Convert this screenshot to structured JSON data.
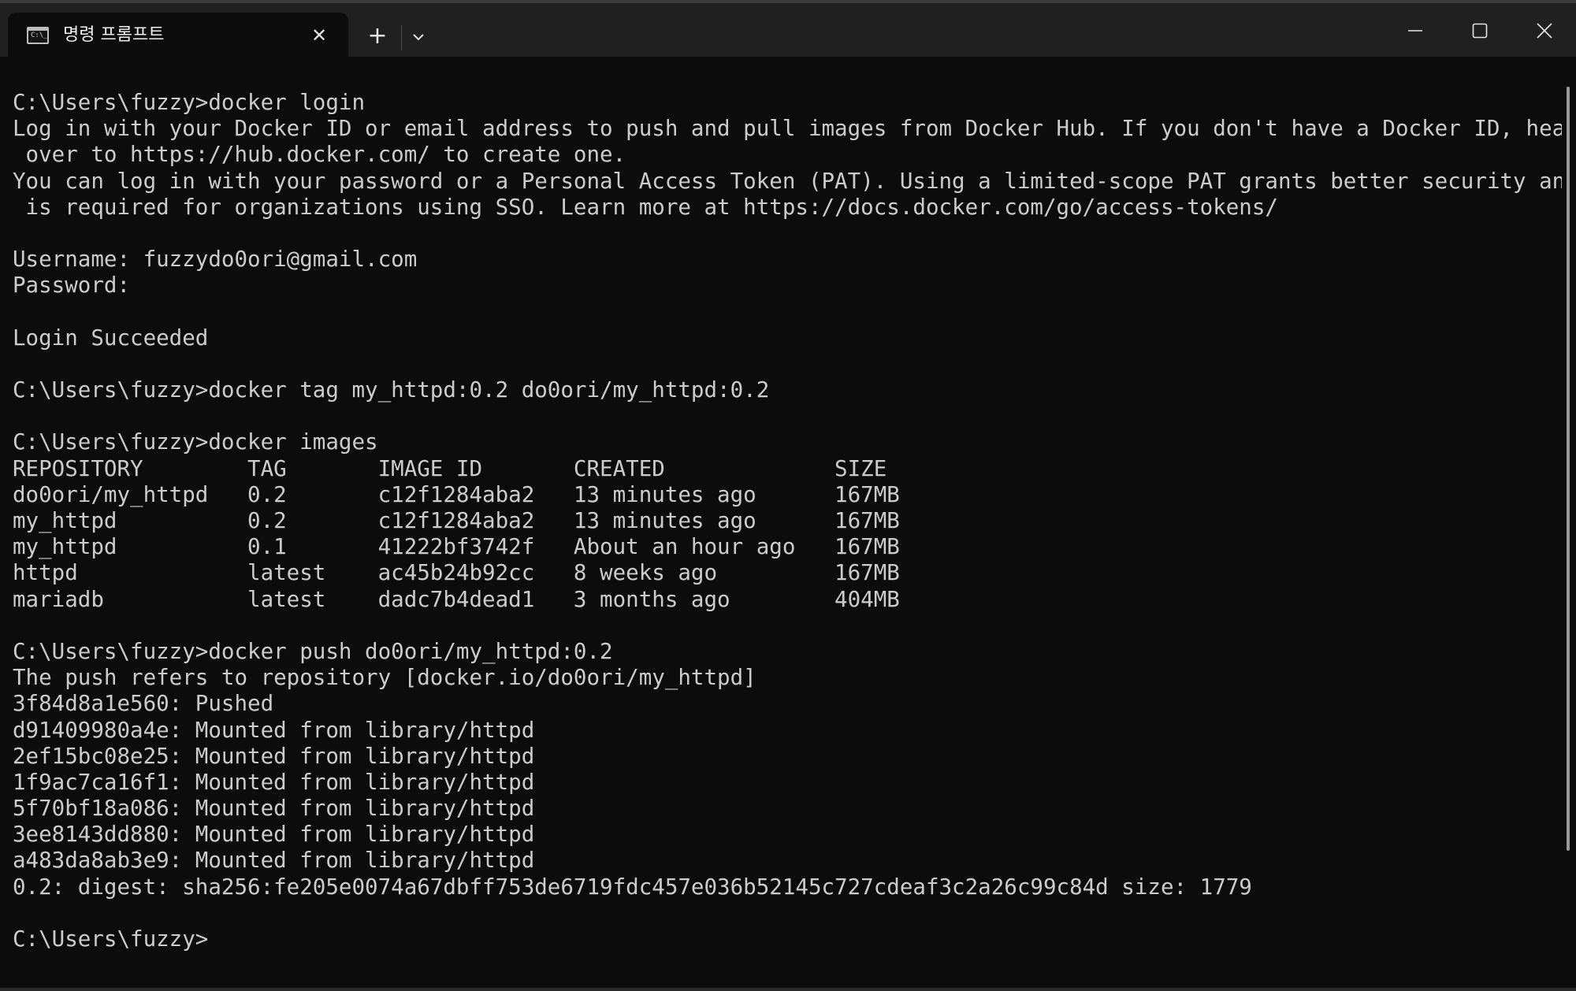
{
  "tab": {
    "title": "명령 프롬프트",
    "icon": "command-prompt-icon",
    "icon_prompt": "C:\\_",
    "close_symbol": "✕"
  },
  "titlebar": {
    "new_tab_symbol": "+",
    "dropdown_icon": "chevron-down-icon",
    "minimize_icon": "minimize-icon",
    "maximize_icon": "maximize-icon",
    "close_icon": "close-icon"
  },
  "terminal": {
    "lines": [
      "C:\\Users\\fuzzy>docker login",
      "Log in with your Docker ID or email address to push and pull images from Docker Hub. If you don't have a Docker ID, head",
      " over to https://hub.docker.com/ to create one.",
      "You can log in with your password or a Personal Access Token (PAT). Using a limited-scope PAT grants better security and",
      " is required for organizations using SSO. Learn more at https://docs.docker.com/go/access-tokens/",
      "",
      "Username: fuzzydo0ori@gmail.com",
      "Password:",
      "",
      "Login Succeeded",
      "",
      "C:\\Users\\fuzzy>docker tag my_httpd:0.2 do0ori/my_httpd:0.2",
      "",
      "C:\\Users\\fuzzy>docker images",
      "REPOSITORY        TAG       IMAGE ID       CREATED             SIZE",
      "do0ori/my_httpd   0.2       c12f1284aba2   13 minutes ago      167MB",
      "my_httpd          0.2       c12f1284aba2   13 minutes ago      167MB",
      "my_httpd          0.1       41222bf3742f   About an hour ago   167MB",
      "httpd             latest    ac45b24b92cc   8 weeks ago         167MB",
      "mariadb           latest    dadc7b4dead1   3 months ago        404MB",
      "",
      "C:\\Users\\fuzzy>docker push do0ori/my_httpd:0.2",
      "The push refers to repository [docker.io/do0ori/my_httpd]",
      "3f84d8a1e560: Pushed",
      "d91409980a4e: Mounted from library/httpd",
      "2ef15bc08e25: Mounted from library/httpd",
      "1f9ac7ca16f1: Mounted from library/httpd",
      "5f70bf18a086: Mounted from library/httpd",
      "3ee8143dd880: Mounted from library/httpd",
      "a483da8ab3e9: Mounted from library/httpd",
      "0.2: digest: sha256:fe205e0074a67dbff753de6719fdc457e036b52145c727cdeaf3c2a26c99c84d size: 1779",
      "",
      "C:\\Users\\fuzzy>"
    ]
  },
  "colors": {
    "background": "#0c0c0c",
    "titlebar": "#202020",
    "text": "#cccccc"
  }
}
